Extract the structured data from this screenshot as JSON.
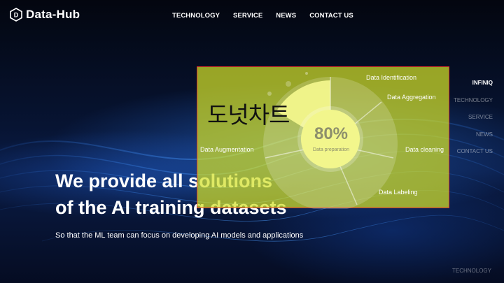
{
  "header": {
    "logo_text": "Data-Hub",
    "nav": [
      "TECHNOLOGY",
      "SERVICE",
      "NEWS",
      "CONTACT US"
    ]
  },
  "side_nav": {
    "items": [
      "INFINIQ",
      "TECHNOLOGY",
      "SERVICE",
      "NEWS",
      "CONTACT US"
    ],
    "active_index": 0,
    "bottom_label": "TECHNOLOGY"
  },
  "hero": {
    "line1": "We provide all solutions",
    "line2": "of the AI training datasets",
    "subtitle": "So that the ML team can focus on developing AI models and applications"
  },
  "overlay": {
    "title": "도넛차트",
    "center_value": "80%",
    "center_label": "Data preparation",
    "segments": [
      "Data Identification",
      "Data Aggregation",
      "Data cleaning",
      "Data Labeling",
      "Data Augmentation"
    ],
    "colors": {
      "overlay": "#d2e128",
      "highlight": "#f2f68c",
      "border": "#e0302a"
    }
  }
}
